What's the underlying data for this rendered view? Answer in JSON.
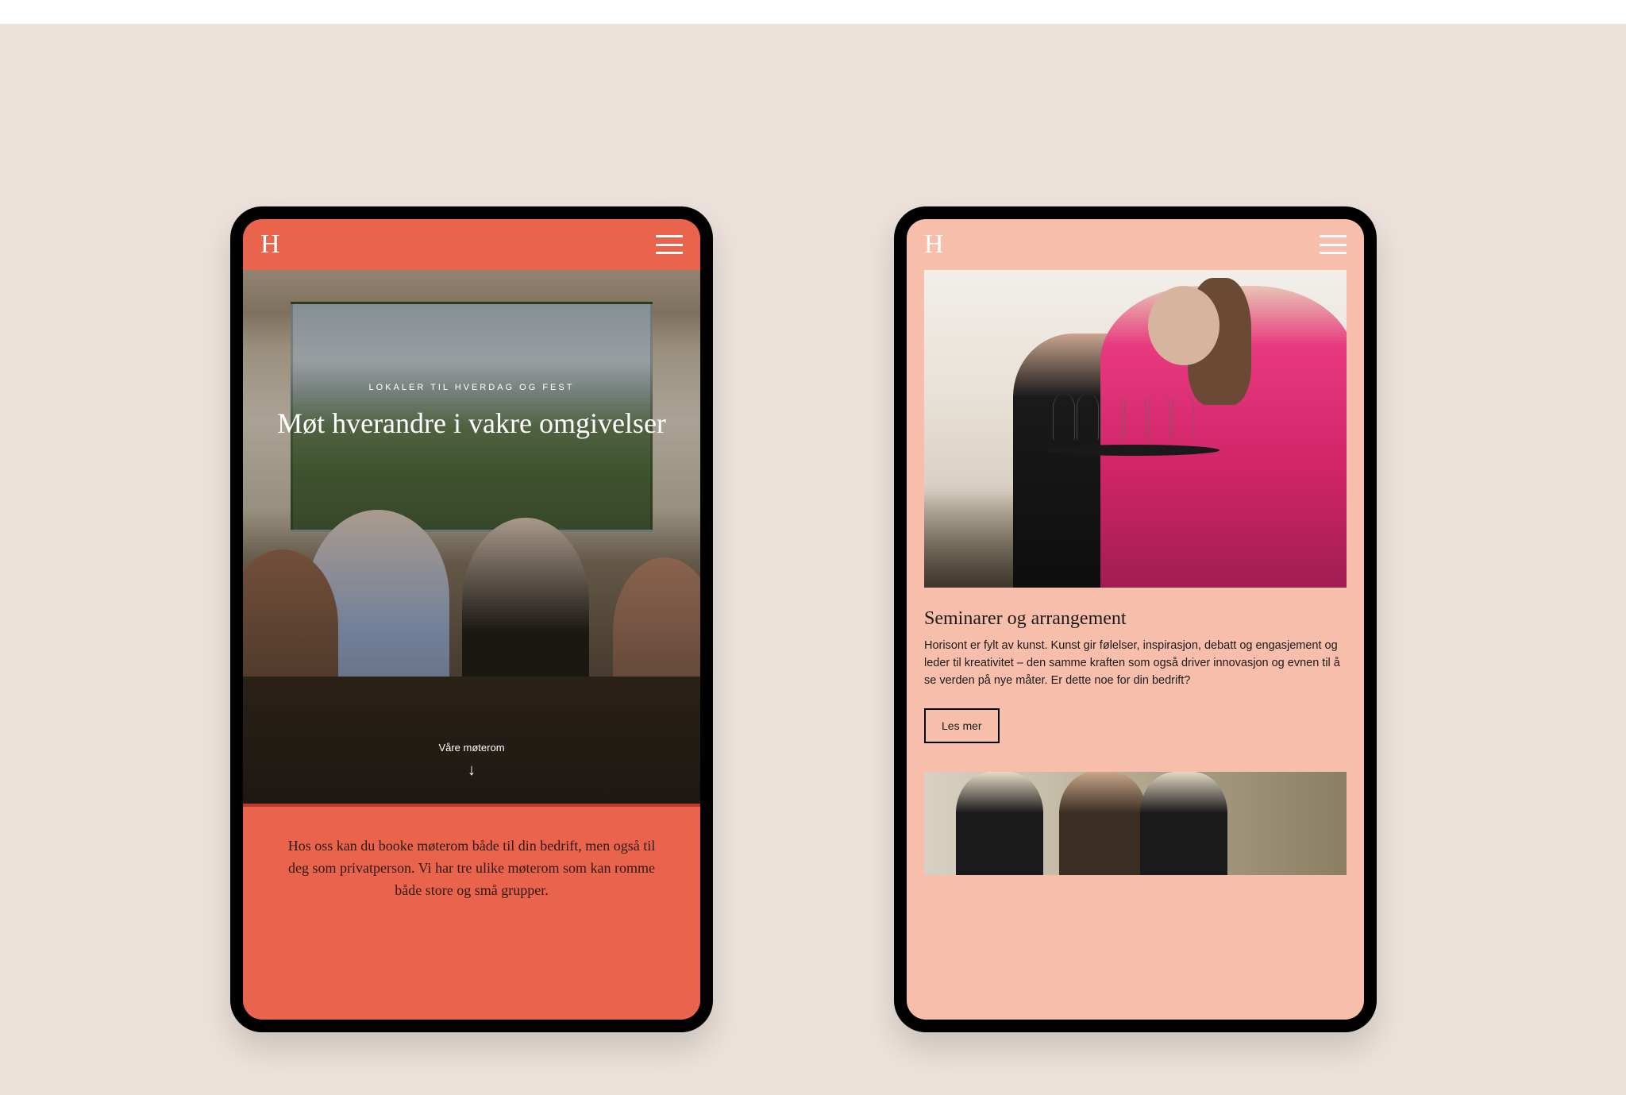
{
  "left": {
    "eyebrow": "LOKALER TIL HVERDAG OG FEST",
    "headline": "Møt hverandre i vakre omgivelser",
    "scroll_label": "Våre møterom",
    "intro": "Hos oss kan du booke møterom både til din bedrift, men også til deg som privatperson. Vi har tre ulike møterom som kan romme både store og små grupper."
  },
  "right": {
    "card": {
      "title": "Seminarer og arrangement",
      "body": "Horisont er fylt av kunst. Kunst gir følelser, inspirasjon, debatt og engasjement og leder til kreativitet – den samme kraften som også driver innovasjon og evnen til å se verden på nye måter. Er dette noe for din bedrift?",
      "cta": "Les mer"
    }
  },
  "colors": {
    "accent_left": "#e9634d",
    "accent_right": "#f7bfab",
    "stage_bg": "#ece2db"
  }
}
